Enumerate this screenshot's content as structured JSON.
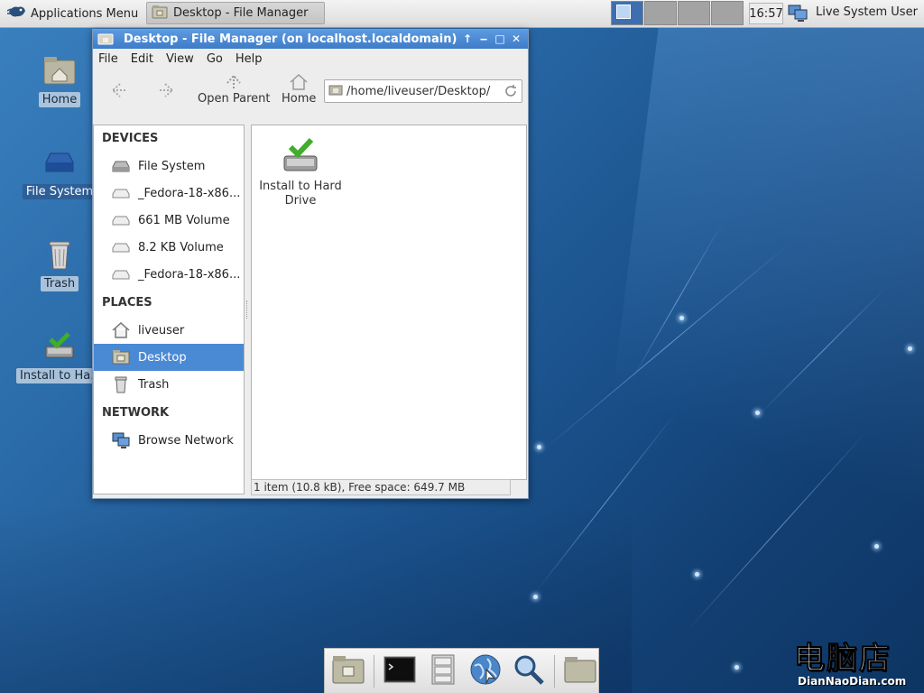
{
  "top_panel": {
    "apps_menu_label": "Applications Menu",
    "task_label": "Desktop - File Manager",
    "clock": "16:57",
    "user": "Live System User"
  },
  "desktop_icons": [
    {
      "label": "Home",
      "icon": "home-folder-icon"
    },
    {
      "label": "File System",
      "icon": "drive-icon"
    },
    {
      "label": "Trash",
      "icon": "trash-icon"
    },
    {
      "label": "Install to Ha...",
      "icon": "install-icon"
    }
  ],
  "window": {
    "title": "Desktop - File Manager (on localhost.localdomain)",
    "menu": [
      "File",
      "Edit",
      "View",
      "Go",
      "Help"
    ],
    "toolbar": {
      "open_parent": "Open Parent",
      "home": "Home"
    },
    "address": "/home/liveuser/Desktop/",
    "sidebar": {
      "devices_heading": "DEVICES",
      "devices": [
        "File System",
        "_Fedora-18-x86...",
        "661 MB Volume",
        "8.2 KB Volume",
        "_Fedora-18-x86..."
      ],
      "places_heading": "PLACES",
      "places": [
        "liveuser",
        "Desktop",
        "Trash"
      ],
      "network_heading": "NETWORK",
      "network": [
        "Browse Network"
      ]
    },
    "files": [
      {
        "name": "Install to Hard Drive"
      }
    ],
    "status": "1 item (10.8 kB), Free space: 649.7 MB"
  },
  "dock": [
    "file-manager-icon",
    "terminal-icon",
    "file-cabinet-icon",
    "web-browser-icon",
    "search-icon",
    "folder-icon"
  ],
  "watermark": {
    "big": "电脑店",
    "small": "DianNaoDian.com"
  },
  "colors": {
    "selection": "#4a89d4",
    "titlebar": "#4a89d4"
  }
}
